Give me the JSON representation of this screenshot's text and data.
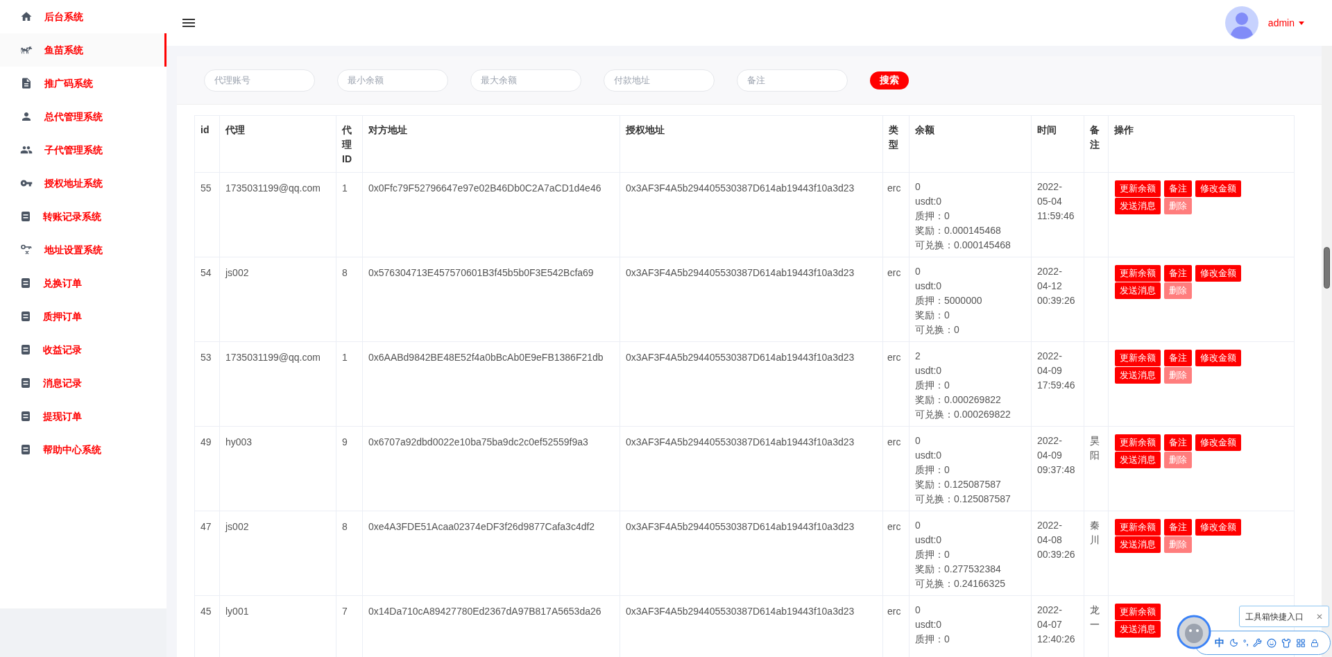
{
  "sidebar": {
    "items": [
      {
        "label": "后台系统",
        "selected": false
      },
      {
        "label": "鱼苗系统",
        "selected": true
      },
      {
        "label": "推广码系统",
        "selected": false
      },
      {
        "label": "总代管理系统",
        "selected": false
      },
      {
        "label": "子代管理系统",
        "selected": false
      },
      {
        "label": "授权地址系统",
        "selected": false
      },
      {
        "label": "转账记录系统",
        "selected": false
      },
      {
        "label": "地址设置系统",
        "selected": false
      },
      {
        "label": "兑换订单",
        "selected": false
      },
      {
        "label": "质押订单",
        "selected": false
      },
      {
        "label": "收益记录",
        "selected": false
      },
      {
        "label": "消息记录",
        "selected": false
      },
      {
        "label": "提现订单",
        "selected": false
      },
      {
        "label": "帮助中心系统",
        "selected": false
      }
    ]
  },
  "header": {
    "user": "admin"
  },
  "search": {
    "fields": [
      {
        "placeholder": "代理账号"
      },
      {
        "placeholder": "最小余额"
      },
      {
        "placeholder": "最大余额"
      },
      {
        "placeholder": "付款地址"
      },
      {
        "placeholder": "备注"
      }
    ],
    "button": "搜索"
  },
  "table": {
    "columns": [
      "id",
      "代理",
      "代理ID",
      "对方地址",
      "授权地址",
      "类型",
      "余额",
      "时间",
      "备注",
      "操作"
    ],
    "rows": [
      {
        "id": "55",
        "agent": "1735031199@qq.com",
        "agent_id": "1",
        "counterparty": "0x0Ffc79F52796647e97e02B46Db0C2A7aCD1d4e46",
        "auth_address": "0x3AF3F4A5b294405530387D614ab19443f10a3d23",
        "type": "erc",
        "balance": [
          "0",
          "usdt:0",
          "质押：0",
          "奖励：0.000145468",
          "可兑换：0.000145468"
        ],
        "time": "2022-05-04 11:59:46",
        "remark": "",
        "actions": [
          [
            {
              "label": "更新余额",
              "disabled": false
            },
            {
              "label": "备注",
              "disabled": false
            },
            {
              "label": "修改金额",
              "disabled": false
            }
          ],
          [
            {
              "label": "发送消息",
              "disabled": false
            },
            {
              "label": "删除",
              "disabled": true
            }
          ]
        ]
      },
      {
        "id": "54",
        "agent": "js002",
        "agent_id": "8",
        "counterparty": "0x576304713E457570601B3f45b5b0F3E542Bcfa69",
        "auth_address": "0x3AF3F4A5b294405530387D614ab19443f10a3d23",
        "type": "erc",
        "balance": [
          "0",
          "usdt:0",
          "质押：5000000",
          "奖励：0",
          "可兑换：0"
        ],
        "time": "2022-04-12 00:39:26",
        "remark": "",
        "actions": [
          [
            {
              "label": "更新余额",
              "disabled": false
            },
            {
              "label": "备注",
              "disabled": false
            },
            {
              "label": "修改金额",
              "disabled": false
            }
          ],
          [
            {
              "label": "发送消息",
              "disabled": false
            },
            {
              "label": "删除",
              "disabled": true
            }
          ]
        ]
      },
      {
        "id": "53",
        "agent": "1735031199@qq.com",
        "agent_id": "1",
        "counterparty": "0x6AABd9842BE48E52f4a0bBcAb0E9eFB1386F21db",
        "auth_address": "0x3AF3F4A5b294405530387D614ab19443f10a3d23",
        "type": "erc",
        "balance": [
          "2",
          "usdt:0",
          "质押：0",
          "奖励：0.000269822",
          "可兑换：0.000269822"
        ],
        "time": "2022-04-09 17:59:46",
        "remark": "",
        "actions": [
          [
            {
              "label": "更新余额",
              "disabled": false
            },
            {
              "label": "备注",
              "disabled": false
            },
            {
              "label": "修改金额",
              "disabled": false
            }
          ],
          [
            {
              "label": "发送消息",
              "disabled": false
            },
            {
              "label": "删除",
              "disabled": true
            }
          ]
        ]
      },
      {
        "id": "49",
        "agent": "hy003",
        "agent_id": "9",
        "counterparty": "0x6707a92dbd0022e10ba75ba9dc2c0ef52559f9a3",
        "auth_address": "0x3AF3F4A5b294405530387D614ab19443f10a3d23",
        "type": "erc",
        "balance": [
          "0",
          "usdt:0",
          "质押：0",
          "奖励：0.125087587",
          "可兑换：0.125087587"
        ],
        "time": "2022-04-09 09:37:48",
        "remark": "昊阳",
        "actions": [
          [
            {
              "label": "更新余额",
              "disabled": false
            },
            {
              "label": "备注",
              "disabled": false
            },
            {
              "label": "修改金额",
              "disabled": false
            }
          ],
          [
            {
              "label": "发送消息",
              "disabled": false
            },
            {
              "label": "删除",
              "disabled": true
            }
          ]
        ]
      },
      {
        "id": "47",
        "agent": "js002",
        "agent_id": "8",
        "counterparty": "0xe4A3FDE51Acaa02374eDF3f26d9877Cafa3c4df2",
        "auth_address": "0x3AF3F4A5b294405530387D614ab19443f10a3d23",
        "type": "erc",
        "balance": [
          "0",
          "usdt:0",
          "质押：0",
          "奖励：0.277532384",
          "可兑换：0.24166325"
        ],
        "time": "2022-04-08 00:39:26",
        "remark": "秦川",
        "actions": [
          [
            {
              "label": "更新余额",
              "disabled": false
            },
            {
              "label": "备注",
              "disabled": false
            },
            {
              "label": "修改金额",
              "disabled": false
            }
          ],
          [
            {
              "label": "发送消息",
              "disabled": false
            },
            {
              "label": "删除",
              "disabled": true
            }
          ]
        ]
      },
      {
        "id": "45",
        "agent": "ly001",
        "agent_id": "7",
        "counterparty": "0x14Da710cA89427780Ed2367dA97B817A5653da26",
        "auth_address": "0x3AF3F4A5b294405530387D614ab19443f10a3d23",
        "type": "erc",
        "balance": [
          "0",
          "usdt:0",
          "质押：0"
        ],
        "time": "2022-04-07 12:40:26",
        "remark": "龙一",
        "actions": [
          [
            {
              "label": "更新余额",
              "disabled": false
            }
          ],
          [
            {
              "label": "发送消息",
              "disabled": false
            }
          ]
        ]
      }
    ]
  },
  "ime_toolbar": {
    "tooltip": "工具箱快捷入口",
    "close": "✕",
    "mode": "中",
    "punctuation": "°,"
  }
}
